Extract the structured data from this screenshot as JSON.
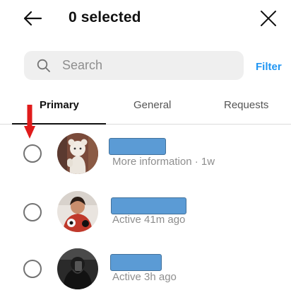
{
  "header": {
    "title": "0 selected",
    "back_icon": "arrow-left-icon",
    "close_icon": "close-icon"
  },
  "search": {
    "placeholder": "Search",
    "value": "",
    "icon": "search-icon"
  },
  "filter_label": "Filter",
  "tabs": [
    {
      "label": "Primary",
      "active": true
    },
    {
      "label": "General",
      "active": false
    },
    {
      "label": "Requests",
      "active": false
    }
  ],
  "threads": [
    {
      "status": "More information · 1w",
      "selected": false
    },
    {
      "status": "Active 41m ago",
      "selected": false
    },
    {
      "status": "Active 3h ago",
      "selected": false
    }
  ],
  "colors": {
    "accent": "#2196f3",
    "redaction": "#5b9bd5",
    "annotation_arrow": "#e01b1b"
  }
}
